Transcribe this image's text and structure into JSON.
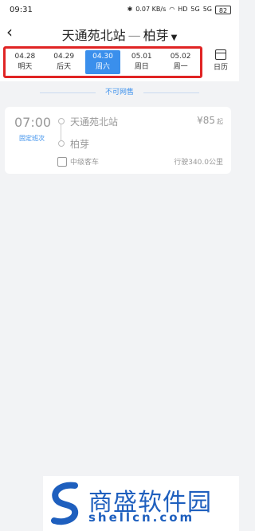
{
  "status_bar": {
    "time": "09:31",
    "speed": "0.07 KB/s",
    "hd": "HD",
    "signal1": "5G",
    "signal2": "5G",
    "battery": "82"
  },
  "header": {
    "from": "天通苑北站",
    "separator": "—",
    "to": "柏芽",
    "dropdown_icon": "chevron-down-icon"
  },
  "dates": [
    {
      "date": "04.28",
      "label": "明天",
      "active": false
    },
    {
      "date": "04.29",
      "label": "后天",
      "active": false
    },
    {
      "date": "04.30",
      "label": "周六",
      "active": true
    },
    {
      "date": "05.01",
      "label": "周日",
      "active": false
    },
    {
      "date": "05.02",
      "label": "周一",
      "active": false
    }
  ],
  "calendar_label": "日历",
  "notice": "不可网售",
  "trip": {
    "departure_time": "07:00",
    "schedule_type": "固定班次",
    "from_station": "天通苑北站",
    "to_station": "柏芽",
    "price": "¥85",
    "price_suffix": "起",
    "bus_type": "中级客车",
    "mileage": "行驶340.0公里"
  },
  "watermark": {
    "name": "商盛软件园",
    "domain": "shellcn.com"
  },
  "colors": {
    "accent": "#3a8fec",
    "highlight_border": "#e02424",
    "watermark": "#1e5fbe"
  }
}
